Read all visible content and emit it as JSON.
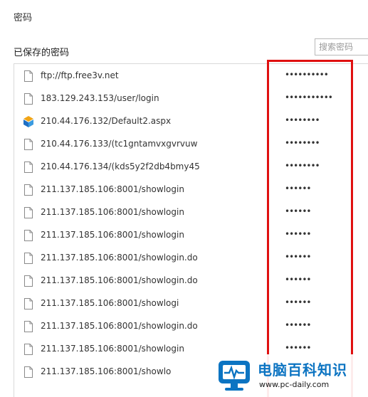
{
  "dialog": {
    "title": "密码"
  },
  "saved_passwords": {
    "title": "已保存的密码",
    "search_placeholder": "搜索密码",
    "rows": [
      {
        "site": "ftp://ftp.free3v.net",
        "password": "••••••••••",
        "icon": "page-icon"
      },
      {
        "site": "183.129.243.153/user/login",
        "password": "•••••••••••",
        "icon": "page-icon"
      },
      {
        "site": "210.44.176.132/Default2.aspx",
        "password": "••••••••",
        "icon": "site-logo-icon"
      },
      {
        "site": "210.44.176.133/(tc1gntamvxgvrvuw",
        "password": "••••••••",
        "icon": "page-icon"
      },
      {
        "site": "210.44.176.134/(kds5y2f2db4bmy45",
        "password": "••••••••",
        "icon": "page-icon"
      },
      {
        "site": "211.137.185.106:8001/showlogin",
        "password": "••••••",
        "icon": "page-icon"
      },
      {
        "site": "211.137.185.106:8001/showlogin",
        "password": "••••••",
        "icon": "page-icon"
      },
      {
        "site": "211.137.185.106:8001/showlogin",
        "password": "••••••",
        "icon": "page-icon"
      },
      {
        "site": "211.137.185.106:8001/showlogin.do",
        "password": "••••••",
        "icon": "page-icon"
      },
      {
        "site": "211.137.185.106:8001/showlogin.do",
        "password": "••••••",
        "icon": "page-icon"
      },
      {
        "site": "211.137.185.106:8001/showlogi",
        "password": "••••••",
        "icon": "page-icon"
      },
      {
        "site": "211.137.185.106:8001/showlogin.do",
        "password": "••••••",
        "icon": "page-icon"
      },
      {
        "site": "211.137.185.106:8001/showlogin",
        "password": "••••••",
        "icon": "page-icon"
      },
      {
        "site": "211.137.185.106:8001/showlo",
        "password": "••••••",
        "icon": "page-icon"
      }
    ]
  },
  "watermark": {
    "name": "电脑百科知识",
    "url": "www.pc-daily.com"
  },
  "colors": {
    "highlight": "#e01010",
    "brand": "#0c74c2"
  }
}
